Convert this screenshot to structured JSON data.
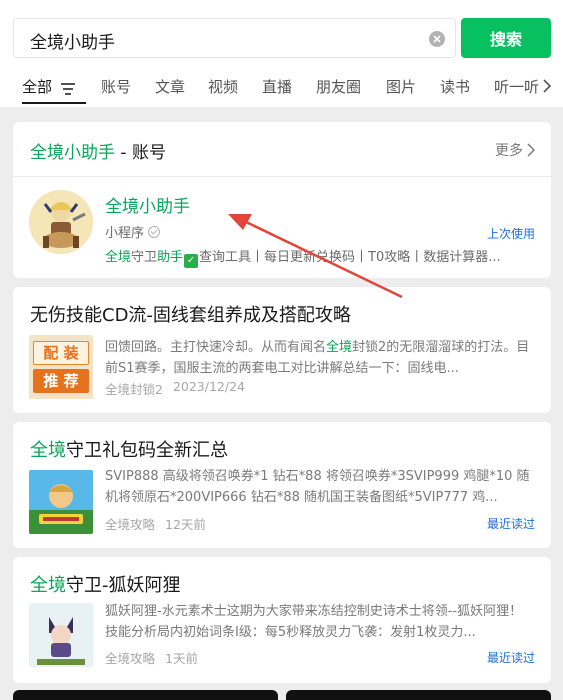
{
  "search": {
    "query": "全境小助手",
    "button_label": "搜索"
  },
  "tabs": [
    {
      "label": "全部",
      "active": true
    },
    {
      "label": "账号"
    },
    {
      "label": "文章"
    },
    {
      "label": "视频"
    },
    {
      "label": "直播"
    },
    {
      "label": "朋友圈"
    },
    {
      "label": "图片"
    },
    {
      "label": "读书"
    },
    {
      "label": "听一听"
    }
  ],
  "account_section": {
    "heading_highlight": "全境小助手",
    "heading_rest": " - 账号",
    "more_label": "更多",
    "name": "全境小助手",
    "type": "小程序",
    "desc_hl1": "全境",
    "desc_mid1": "守卫",
    "desc_hl2": "助手",
    "desc_rest": "查询工具丨每日更新兑换码丨T0攻略丨数据计算器...",
    "status": "上次使用"
  },
  "articles": [
    {
      "title": "无伤技能CD流-固线套组养成及搭配攻略",
      "body_pre": "回馈回路。主打快速冷却。从而有闻名",
      "body_hl": "全境",
      "body_post": "封锁2的无限溜溜球的打法。目前S1赛季，国服主流的两套电工对比讲解总结一下：固线电...",
      "source": "全境封锁2",
      "date": "2023/12/24",
      "thumb_text_1": "配 装",
      "thumb_text_2": "推 荐"
    },
    {
      "title_hl": "全境",
      "title_rest": "守卫礼包码全新汇总",
      "body": "SVIP888 高级将领召唤券*1 钻石*88 将领召唤券*3SVIP999 鸡腿*10 随机将领原石*200VIP666 钻石*88 随机国王装备图纸*5VIP777 鸡...",
      "source": "全境攻略",
      "date": "12天前",
      "status": "最近读过"
    },
    {
      "title_hl": "全境",
      "title_rest": "守卫-狐妖阿狸",
      "body": "狐妖阿狸-水元素术士这期为大家带来冻结控制史诗术士将领--狐妖阿狸！技能分析局内初始词条I级：每5秒释放灵力飞袭：发射1枚灵力...",
      "source": "全境攻略",
      "date": "1天前",
      "status": "最近读过"
    }
  ],
  "colors": {
    "accent": "#07c160",
    "link": "#1e6fd9",
    "annotation_arrow": "#e2463b"
  }
}
